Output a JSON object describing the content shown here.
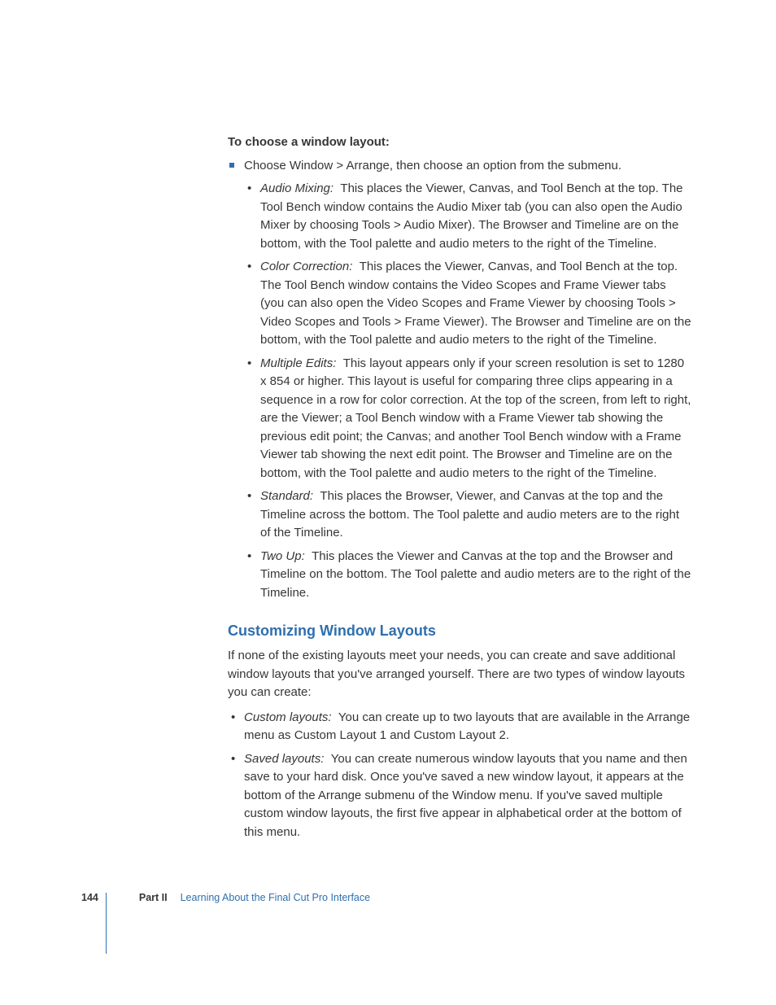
{
  "instruction": "To choose a window layout:",
  "squareItem": {
    "text": "Choose Window > Arrange, then choose an option from the submenu.",
    "sub": [
      {
        "term": "Audio Mixing",
        "body": "This places the Viewer, Canvas, and Tool Bench at the top. The Tool Bench window contains the Audio Mixer tab (you can also open the Audio Mixer by choosing Tools > Audio Mixer). The Browser and Timeline are on the bottom, with the Tool palette and audio meters to the right of the Timeline."
      },
      {
        "term": "Color Correction",
        "body": "This places the Viewer, Canvas, and Tool Bench at the top. The Tool Bench window contains the Video Scopes and Frame Viewer tabs (you can also open the Video Scopes and Frame Viewer by choosing Tools > Video Scopes and Tools > Frame Viewer). The Browser and Timeline are on the bottom, with the Tool palette and audio meters to the right of the Timeline."
      },
      {
        "term": "Multiple Edits",
        "body": "This layout appears only if your screen resolution is set to 1280 x 854 or higher. This layout is useful for comparing three clips appearing in a sequence in a row for color correction. At the top of the screen, from left to right, are the Viewer; a Tool Bench window with a Frame Viewer tab showing the previous edit point; the Canvas; and another Tool Bench window with a Frame Viewer tab showing the next edit point. The Browser and Timeline are on the bottom, with the Tool palette and audio meters to the right of the Timeline."
      },
      {
        "term": "Standard",
        "body": "This places the Browser, Viewer, and Canvas at the top and the Timeline across the bottom. The Tool palette and audio meters are to the right of the Timeline."
      },
      {
        "term": "Two Up",
        "body": "This places the Viewer and Canvas at the top and the Browser and Timeline on the bottom. The Tool palette and audio meters are to the right of the Timeline."
      }
    ]
  },
  "heading": "Customizing Window Layouts",
  "introPara": "If none of the existing layouts meet your needs, you can create and save additional window layouts that you've arranged yourself. There are two types of window layouts you can create:",
  "layoutTypes": [
    {
      "term": "Custom layouts",
      "body": "You can create up to two layouts that are available in the Arrange menu as Custom Layout 1 and Custom Layout 2."
    },
    {
      "term": "Saved layouts",
      "body": "You can create numerous window layouts that you name and then save to your hard disk. Once you've saved a new window layout, it appears at the bottom of the Arrange submenu of the Window menu. If you've saved multiple custom window layouts, the first five appear in alphabetical order at the bottom of this menu."
    }
  ],
  "footer": {
    "page": "144",
    "part": "Part II",
    "title": "Learning About the Final Cut Pro Interface"
  }
}
